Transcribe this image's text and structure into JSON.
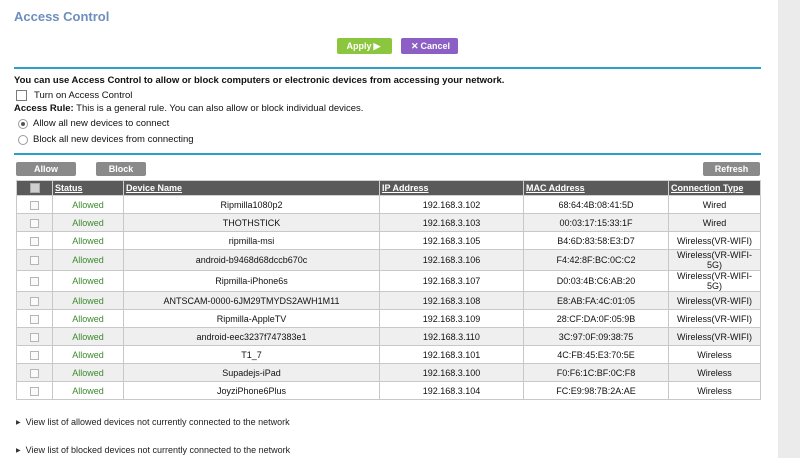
{
  "page": {
    "title": "Access Control"
  },
  "toolbar": {
    "apply_label": "Apply",
    "apply_icon": "arrow-right-icon",
    "cancel_label": "Cancel",
    "cancel_icon": "x-icon"
  },
  "intro_text": "You can use Access Control to allow or block computers or electronic devices from accessing your network.",
  "turn_on_label": "Turn on Access Control",
  "access_rule": {
    "label": "Access Rule:",
    "description": "This is a general rule. You can also allow or block individual devices.",
    "options": [
      {
        "label": "Allow all new devices to connect",
        "selected": true
      },
      {
        "label": "Block all new devices from connecting",
        "selected": false
      }
    ]
  },
  "actions": {
    "allow_label": "Allow",
    "block_label": "Block",
    "refresh_label": "Refresh"
  },
  "table": {
    "headers": [
      "Status",
      "Device Name",
      "IP Address",
      "MAC Address",
      "Connection Type"
    ],
    "rows": [
      {
        "status": "Allowed",
        "device": "Ripmilla1080p2",
        "ip": "192.168.3.102",
        "mac": "68:64:4B:08:41:5D",
        "type": "Wired"
      },
      {
        "status": "Allowed",
        "device": "THOTHSTICK",
        "ip": "192.168.3.103",
        "mac": "00:03:17:15:33:1F",
        "type": "Wired"
      },
      {
        "status": "Allowed",
        "device": "ripmilla-msi",
        "ip": "192.168.3.105",
        "mac": "B4:6D:83:58:E3:D7",
        "type": "Wireless(VR-WIFI)"
      },
      {
        "status": "Allowed",
        "device": "android-b9468d68dccb670c",
        "ip": "192.168.3.106",
        "mac": "F4:42:8F:BC:0C:C2",
        "type": "Wireless(VR-WIFI-5G)"
      },
      {
        "status": "Allowed",
        "device": "Ripmilla-iPhone6s",
        "ip": "192.168.3.107",
        "mac": "D0:03:4B:C6:AB:20",
        "type": "Wireless(VR-WIFI-5G)"
      },
      {
        "status": "Allowed",
        "device": "ANTSCAM-0000-6JM29TMYDS2AWH1M11",
        "ip": "192.168.3.108",
        "mac": "E8:AB:FA:4C:01:05",
        "type": "Wireless(VR-WIFI)"
      },
      {
        "status": "Allowed",
        "device": "Ripmilla-AppleTV",
        "ip": "192.168.3.109",
        "mac": "28:CF:DA:0F:05:9B",
        "type": "Wireless(VR-WIFI)"
      },
      {
        "status": "Allowed",
        "device": "android-eec3237f747383e1",
        "ip": "192.168.3.110",
        "mac": "3C:97:0F:09:38:75",
        "type": "Wireless(VR-WIFI)"
      },
      {
        "status": "Allowed",
        "device": "T1_7",
        "ip": "192.168.3.101",
        "mac": "4C:FB:45:E3:70:5E",
        "type": "Wireless"
      },
      {
        "status": "Allowed",
        "device": "Supadejs-iPad",
        "ip": "192.168.3.100",
        "mac": "F0:F6:1C:BF:0C:F8",
        "type": "Wireless"
      },
      {
        "status": "Allowed",
        "device": "JoyziPhone6Plus",
        "ip": "192.168.3.104",
        "mac": "FC:E9:98:7B:2A:AE",
        "type": "Wireless"
      }
    ]
  },
  "links": {
    "allowed_not_connected": "View list of allowed devices not currently connected to the network",
    "blocked_not_connected": "View list of blocked devices not currently connected to the network"
  },
  "colors": {
    "title": "#6d8ebf",
    "apply": "#8cc63f",
    "cancel": "#8b5fc4",
    "divider": "#2aa0c8",
    "status_allowed": "#3c8a2e",
    "header_bg": "#5a5a5a"
  }
}
